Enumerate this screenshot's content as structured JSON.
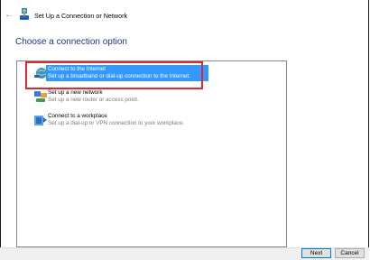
{
  "window": {
    "title": "Set Up a Connection or Network",
    "back_icon": "back-arrow-icon",
    "app_icon": "network-wizard-icon"
  },
  "heading": "Choose a connection option",
  "options": [
    {
      "title": "Connect to the Internet",
      "description": "Set up a broadband or dial-up connection to the Internet.",
      "icon": "globe-icon",
      "selected": true
    },
    {
      "title": "Set up a new network",
      "description": "Set up a new router or access point.",
      "icon": "router-icon",
      "selected": false
    },
    {
      "title": "Connect to a workplace",
      "description": "Set up a dial-up or VPN connection to your workplace.",
      "icon": "workplace-icon",
      "selected": false
    }
  ],
  "buttons": {
    "next": "Next",
    "cancel": "Cancel"
  },
  "colors": {
    "heading": "#1e3287",
    "selection": "#3399ff",
    "highlight_box": "#e3262b"
  }
}
